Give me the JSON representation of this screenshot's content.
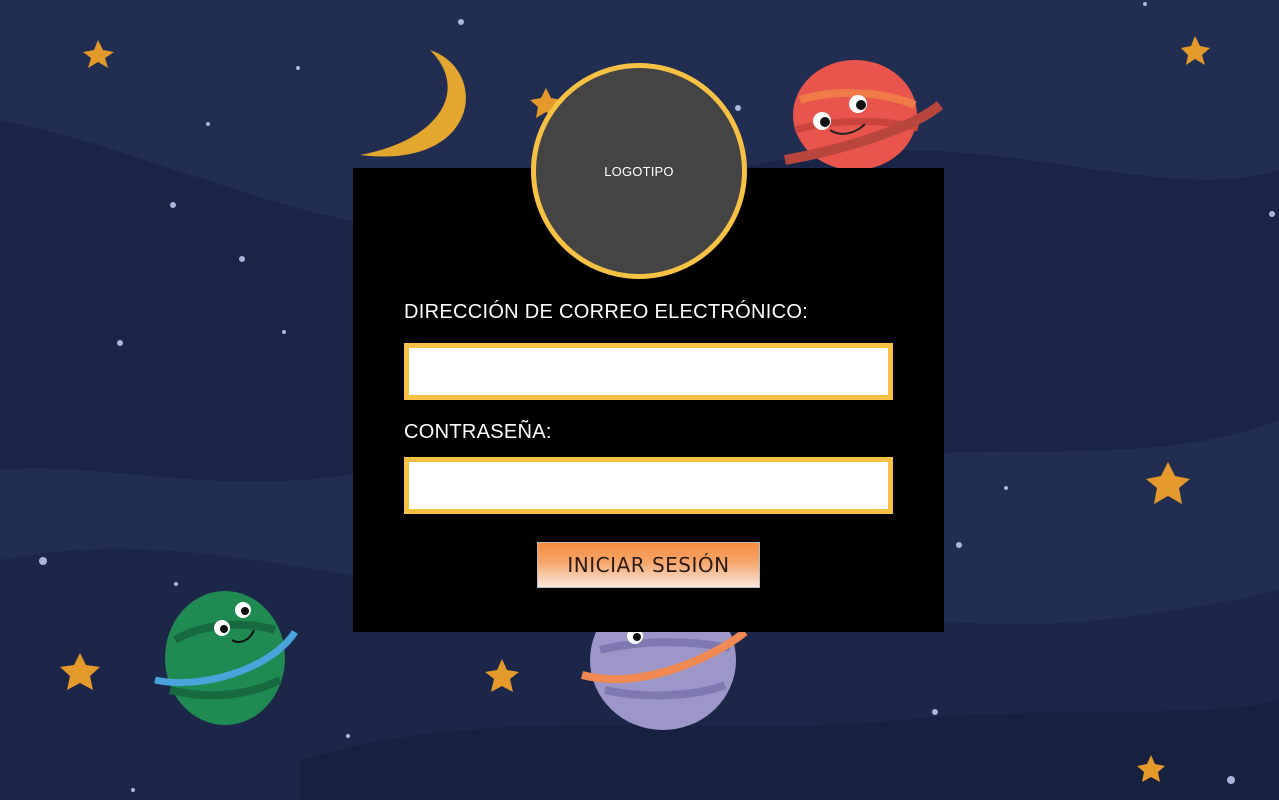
{
  "colors": {
    "background": "#222d52",
    "card": "#000000",
    "accent": "#f7c244",
    "button_top": "#f58a3c",
    "button_bottom": "#f8e7dc"
  },
  "logo": {
    "label": "LOGOTIPO"
  },
  "form": {
    "email_label": "DIRECCIÓN DE CORREO ELECTRÓNICO:",
    "email_value": "",
    "password_label": "CONTRASEÑA:",
    "password_value": "",
    "submit_label": "INICIAR SESIÓN"
  }
}
